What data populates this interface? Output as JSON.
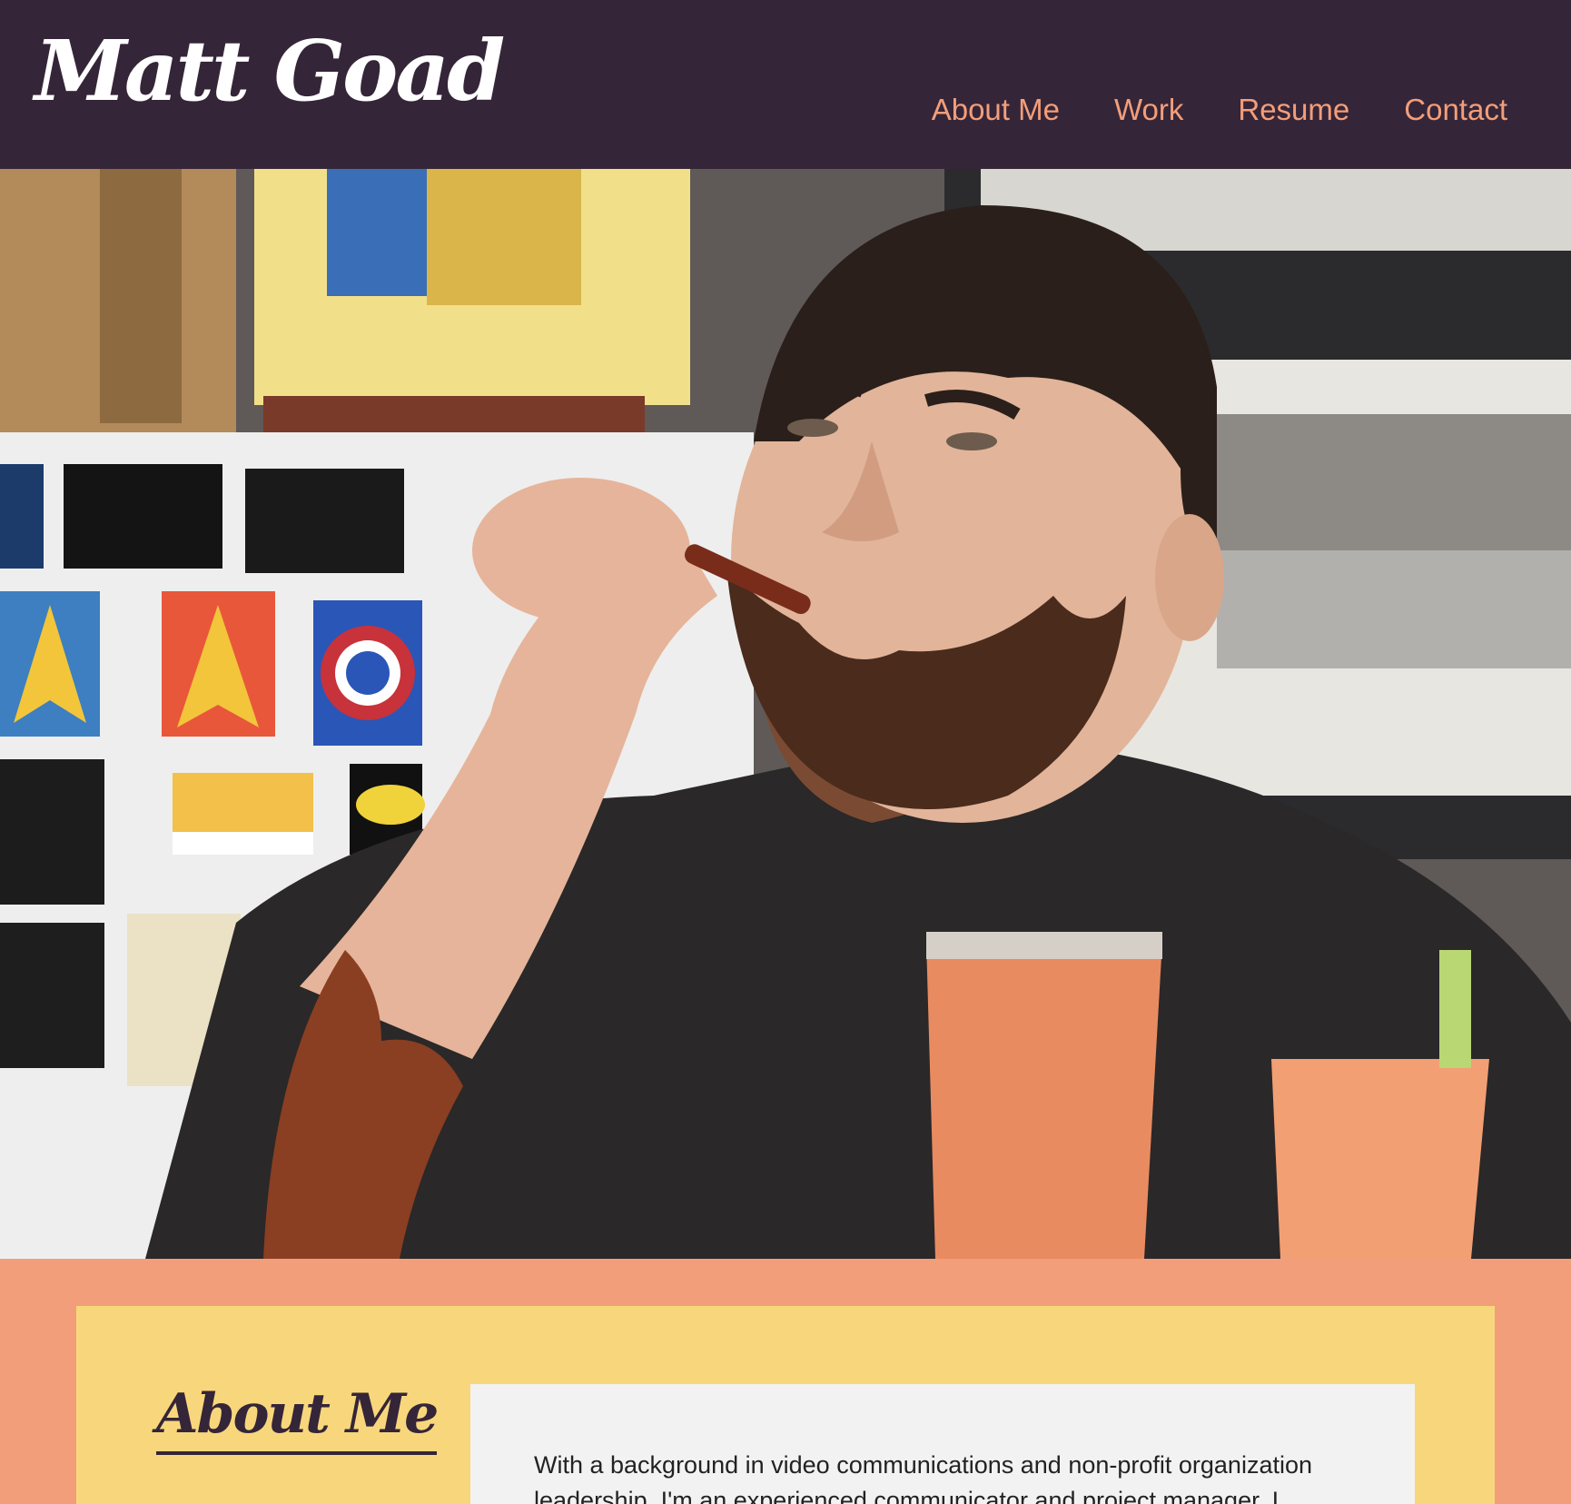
{
  "header": {
    "logo": "Matt Goad",
    "nav": [
      "About Me",
      "Work",
      "Resume",
      "Contact"
    ]
  },
  "hero": {
    "alt": "Photo of Matt Goad eating bacon"
  },
  "about": {
    "title": "About Me",
    "text": "With a background in video communications and non-profit organization leadership, I'm an experienced communicator and project manager. I"
  },
  "colors": {
    "header_bg": "#352538",
    "accent": "#f29e7a",
    "about_bg": "#f8d77c",
    "card_bg": "#f3f2f2"
  }
}
